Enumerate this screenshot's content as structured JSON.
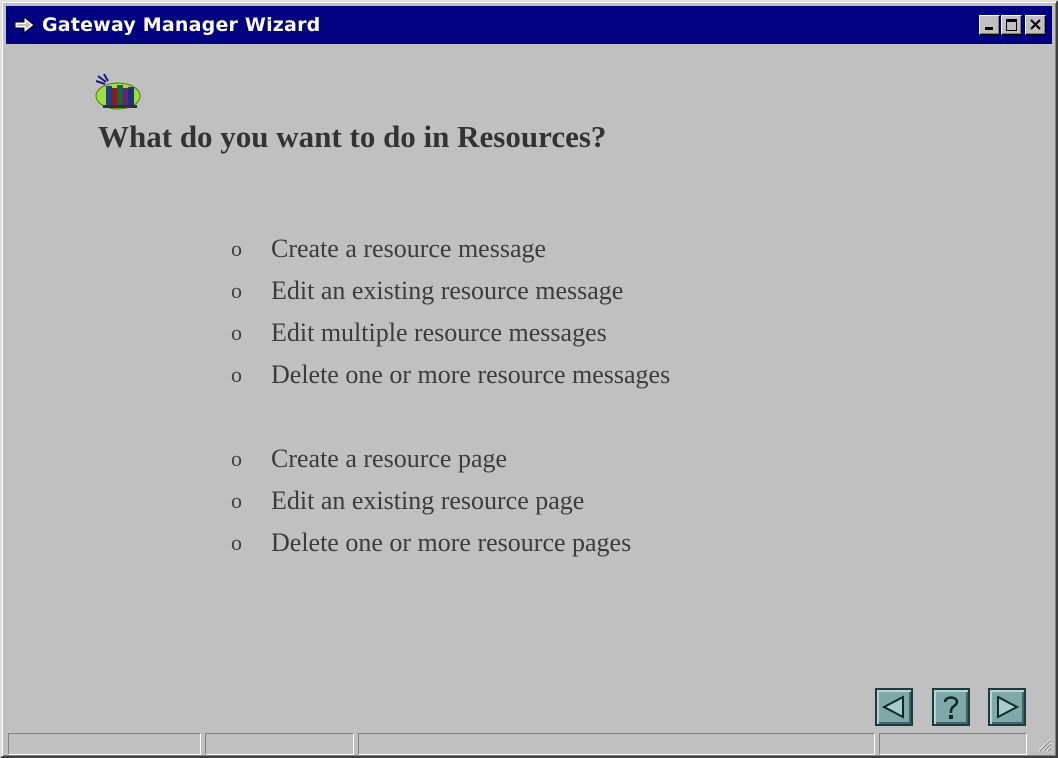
{
  "window": {
    "title": "Gateway Manager Wizard"
  },
  "page": {
    "title": "What do you want to do in Resources?"
  },
  "options": {
    "bullet": "o",
    "messages": [
      "Create a resource message",
      "Edit an existing resource message",
      "Edit multiple resource messages",
      "Delete one or more resource messages"
    ],
    "pages": [
      "Create a resource page",
      "Edit an existing resource page",
      "Delete one or more resource pages"
    ]
  },
  "statusbar": {
    "panes": [
      "",
      "",
      "",
      ""
    ]
  },
  "colors": {
    "titlebar": "#000080",
    "background": "#c0c0c0",
    "nav_button": "#7fa8a8"
  },
  "icons": {
    "title_icon": "wizard-arrow-icon",
    "app_icon": "resources-books-icon",
    "nav_back": "back-arrow-icon",
    "nav_help": "help-question-icon",
    "nav_next": "next-arrow-icon"
  }
}
